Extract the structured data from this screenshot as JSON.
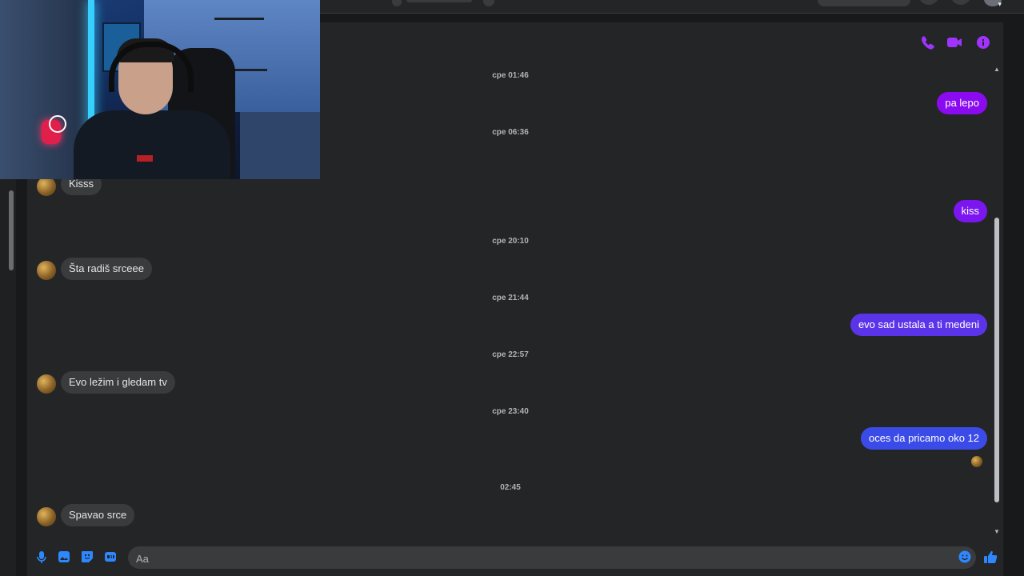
{
  "messages": {
    "ts1": "cpe 01:46",
    "out1": "pa lepo",
    "ts2": "cpe 06:36",
    "in1": "Kisss",
    "out2": "kiss",
    "ts3": "cpe 20:10",
    "in2": "Šta radiš srceee",
    "ts4": "cpe 21:44",
    "out3": "evo sad ustala a ti medeni",
    "ts5": "cpe 22:57",
    "in3": "Evo ležim i gledam tv",
    "ts6": "cpe 23:40",
    "out4": "oces da pricamo oko 12",
    "ts7": "02:45",
    "in4": "Spavao srce"
  },
  "composer": {
    "placeholder": "Aa"
  },
  "colors": {
    "accent": "#a033ff",
    "composer_icon": "#2d88ff",
    "bubble_out_1": "#8a0bef",
    "bubble_out_2": "#7b16f0",
    "bubble_out_3": "#5b34ea",
    "bubble_out_4": "#3b4be8"
  },
  "icons": {
    "header": [
      "phone-icon",
      "video-camera-icon",
      "info-icon"
    ],
    "composer": [
      "microphone-icon",
      "image-icon",
      "sticker-icon",
      "gif-icon",
      "emoji-icon",
      "thumbs-up-icon"
    ]
  }
}
